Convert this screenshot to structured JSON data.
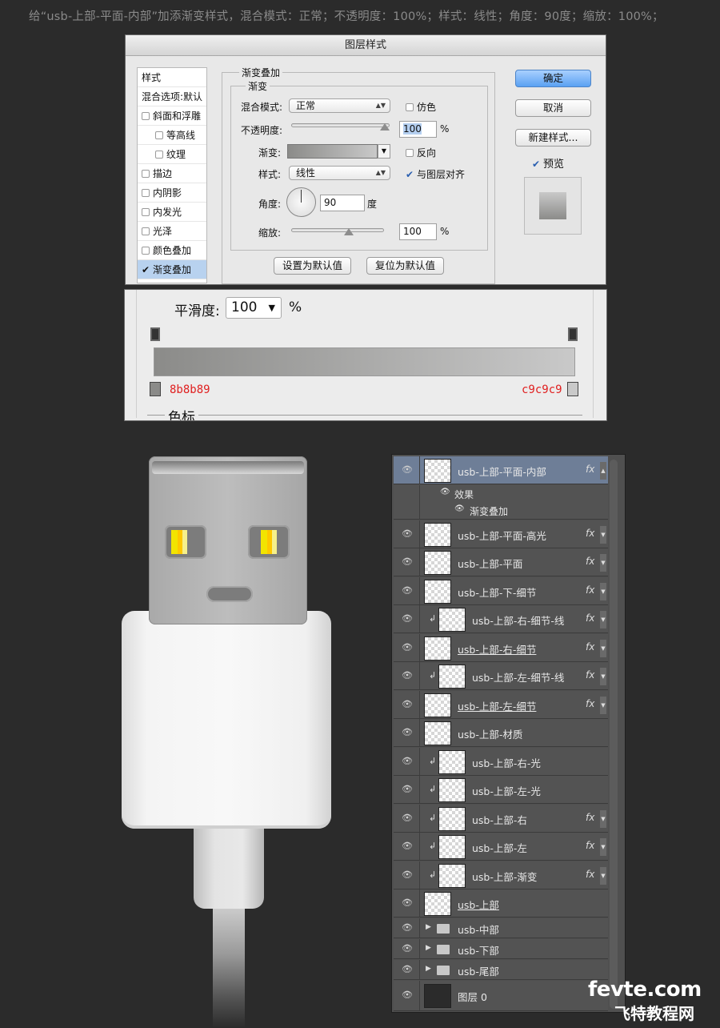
{
  "caption": "给“usb-上部-平面-内部”加添渐变样式，混合模式：正常；不透明度：100%；样式：线性；角度：90度；缩放：100%；",
  "dialog": {
    "title": "图层样式",
    "sidebar": {
      "header": "样式",
      "blend": "混合选项:默认",
      "items": [
        "斜面和浮雕",
        "等高线",
        "纹理",
        "描边",
        "内阴影",
        "内发光",
        "光泽",
        "颜色叠加",
        "渐变叠加"
      ]
    },
    "section_title": "渐变叠加",
    "group_title": "渐变",
    "blend_mode_label": "混合模式:",
    "blend_mode_value": "正常",
    "dither_label": "仿色",
    "opacity_label": "不透明度:",
    "opacity_value": "100",
    "percent": "%",
    "gradient_label": "渐变:",
    "reverse_label": "反向",
    "style_label": "样式:",
    "style_value": "线性",
    "align_label": "与图层对齐",
    "angle_label": "角度:",
    "angle_value": "90",
    "angle_unit": "度",
    "scale_label": "缩放:",
    "scale_value": "100",
    "set_default": "设置为默认值",
    "reset_default": "复位为默认值",
    "ok": "确定",
    "cancel": "取消",
    "new_style": "新建样式...",
    "preview": "预览"
  },
  "gradient_editor": {
    "smooth_label": "平滑度:",
    "smooth_value": "100",
    "percent": "%",
    "left_color": "8b8b89",
    "right_color": "c9c9c9",
    "stops_label": "色标"
  },
  "layers": [
    {
      "name": "usb-上部-平面-内部",
      "fx": true,
      "clip": false,
      "selected": true
    },
    {
      "name": "usb-上部-平面-高光",
      "fx": true,
      "clip": false
    },
    {
      "name": "usb-上部-平面",
      "fx": true,
      "clip": false
    },
    {
      "name": "usb-上部-下-细节",
      "fx": true,
      "clip": false
    },
    {
      "name": "usb-上部-右-细节-线",
      "fx": true,
      "clip": true
    },
    {
      "name": "usb-上部-右-细节",
      "fx": true,
      "clip": false
    },
    {
      "name": "usb-上部-左-细节-线",
      "fx": true,
      "clip": true
    },
    {
      "name": "usb-上部-左-细节",
      "fx": true,
      "clip": false
    },
    {
      "name": "usb-上部-材质",
      "fx": false,
      "clip": false
    },
    {
      "name": "usb-上部-右-光",
      "fx": false,
      "clip": true
    },
    {
      "name": "usb-上部-左-光",
      "fx": false,
      "clip": true
    },
    {
      "name": "usb-上部-右",
      "fx": true,
      "clip": true
    },
    {
      "name": "usb-上部-左",
      "fx": true,
      "clip": true
    },
    {
      "name": "usb-上部-渐变",
      "fx": true,
      "clip": true
    },
    {
      "name": "usb-上部",
      "fx": false,
      "clip": false
    },
    {
      "name": "usb-中部",
      "group": true
    },
    {
      "name": "usb-下部",
      "group": true
    },
    {
      "name": "usb-尾部",
      "group": true
    },
    {
      "name": "图层 0",
      "fx": false
    }
  ],
  "effects_label": "效果",
  "effect_item": "渐变叠加",
  "fx_label": "fx",
  "watermark": {
    "line1": "fevte.com",
    "line2": "飞特教程网"
  }
}
